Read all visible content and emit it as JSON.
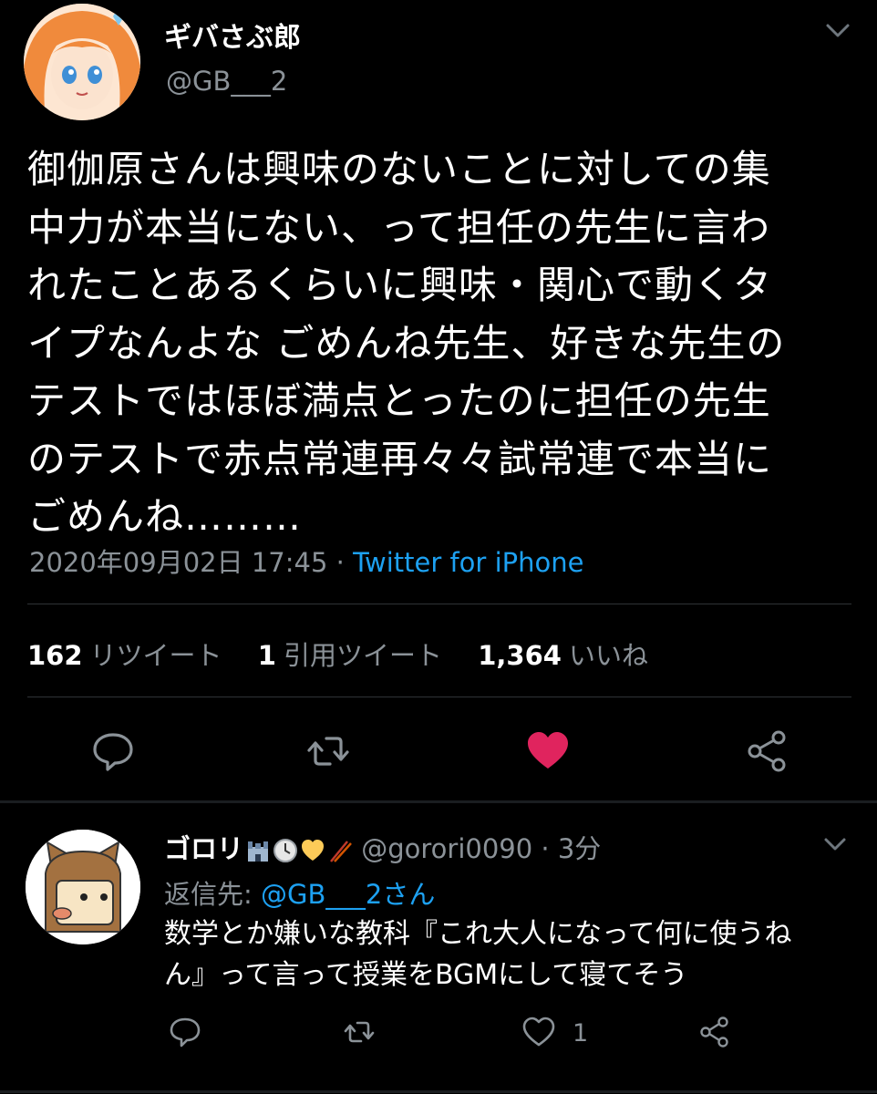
{
  "tweet": {
    "display_name": "ギバさぶ郎",
    "handle": "@GB___2",
    "text": "御伽原さんは興味のないことに対しての集\n中力が本当にない、って担任の先生に言わ\nれたことあるくらいに興味・関心で動くタ\nイプなんよな ごめんね先生、好きな先生の\nテストではほぼ満点とったのに担任の先生\nのテストで赤点常連再々々試常連で本当に\nごめんね………",
    "timestamp": "2020年09月02日 17:45",
    "separator": " · ",
    "source": "Twitter for iPhone",
    "stats": {
      "retweets_count": "162",
      "retweets_label": "リツイート",
      "quotes_count": "1",
      "quotes_label": "引用ツイート",
      "likes_count": "1,364",
      "likes_label": "いいね"
    },
    "liked": true
  },
  "reply": {
    "display_name": "ゴロリ",
    "emojis": [
      "castle-icon",
      "clock-icon",
      "yellow-heart-icon",
      "chopsticks-icon"
    ],
    "handle": "@gorori0090",
    "time_sep": " · ",
    "time": "3分",
    "replying_prefix": "返信先: ",
    "replying_to": "@GB___2さん",
    "text": "数学とか嫌いな教科『これ大人になって何に使うね\nん』って言って授業をBGMにして寝てそう",
    "like_count": "1"
  },
  "colors": {
    "background": "#000000",
    "muted": "#8b9298",
    "link": "#1da1f2",
    "like": "#e0245e",
    "divider": "#2f3336"
  }
}
